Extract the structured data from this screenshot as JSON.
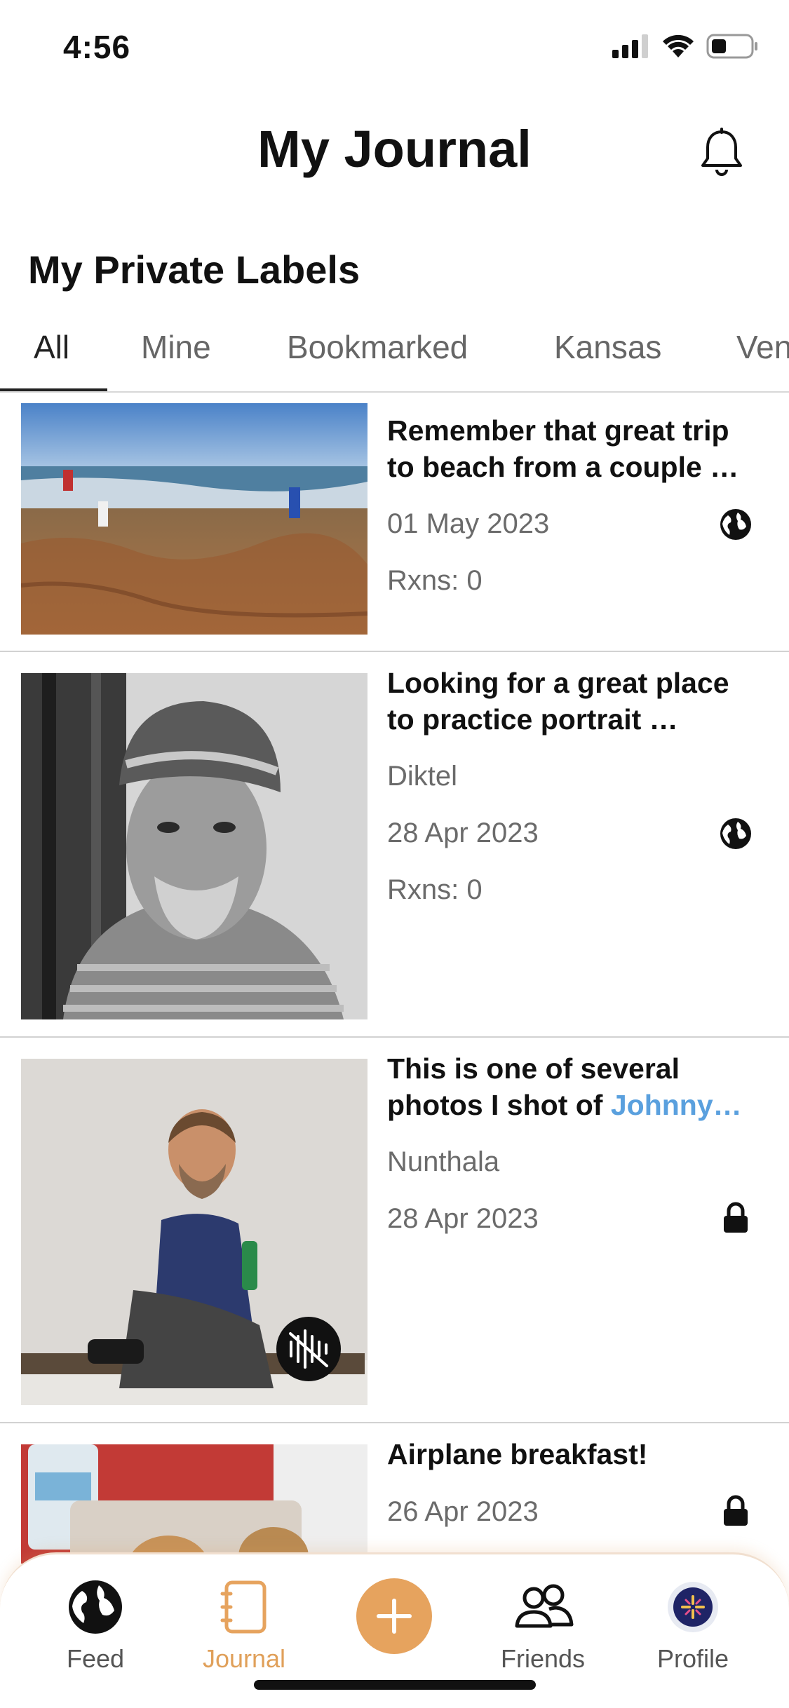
{
  "status_bar": {
    "time": "4:56"
  },
  "header": {
    "title": "My Journal"
  },
  "section": {
    "title": "My Private Labels"
  },
  "tabs": [
    {
      "label": "All",
      "active": true
    },
    {
      "label": "Mine",
      "active": false
    },
    {
      "label": "Bookmarked",
      "active": false
    },
    {
      "label": "Kansas",
      "active": false
    },
    {
      "label": "Ven",
      "active": false
    }
  ],
  "entries": [
    {
      "title_line1": "Remember that great trip",
      "title_line2": "to beach from a couple …",
      "date": "01 May 2023",
      "reactions": "Rxns: 0",
      "visibility_icon": "globe-icon"
    },
    {
      "title_line1": "Looking for a great place",
      "title_line2": "to practice portrait …",
      "location": "Diktel",
      "date": "28 Apr 2023",
      "reactions": "Rxns: 0",
      "visibility_icon": "globe-icon"
    },
    {
      "title_line1": "This is one of several",
      "title_line2_prefix": "photos I shot of ",
      "title_line2_mention": "Johnny…",
      "location": "Nunthala",
      "date": "28 Apr 2023",
      "visibility_icon": "lock-icon",
      "media_badge_icon": "audio-muted-icon"
    },
    {
      "title_line1": "Airplane breakfast!",
      "date": "26 Apr 2023",
      "visibility_icon": "lock-icon"
    }
  ],
  "bottom_nav": {
    "items": [
      {
        "label": "Feed",
        "icon": "globe-icon"
      },
      {
        "label": "Journal",
        "icon": "journal-icon",
        "active": true
      },
      {
        "label": "",
        "icon": "plus-icon"
      },
      {
        "label": "Friends",
        "icon": "friends-icon"
      },
      {
        "label": "Profile",
        "icon": "avatar"
      }
    ]
  },
  "colors": {
    "accent": "#e6a35e",
    "mention": "#5aa0de",
    "divider": "#d2d2d2"
  }
}
